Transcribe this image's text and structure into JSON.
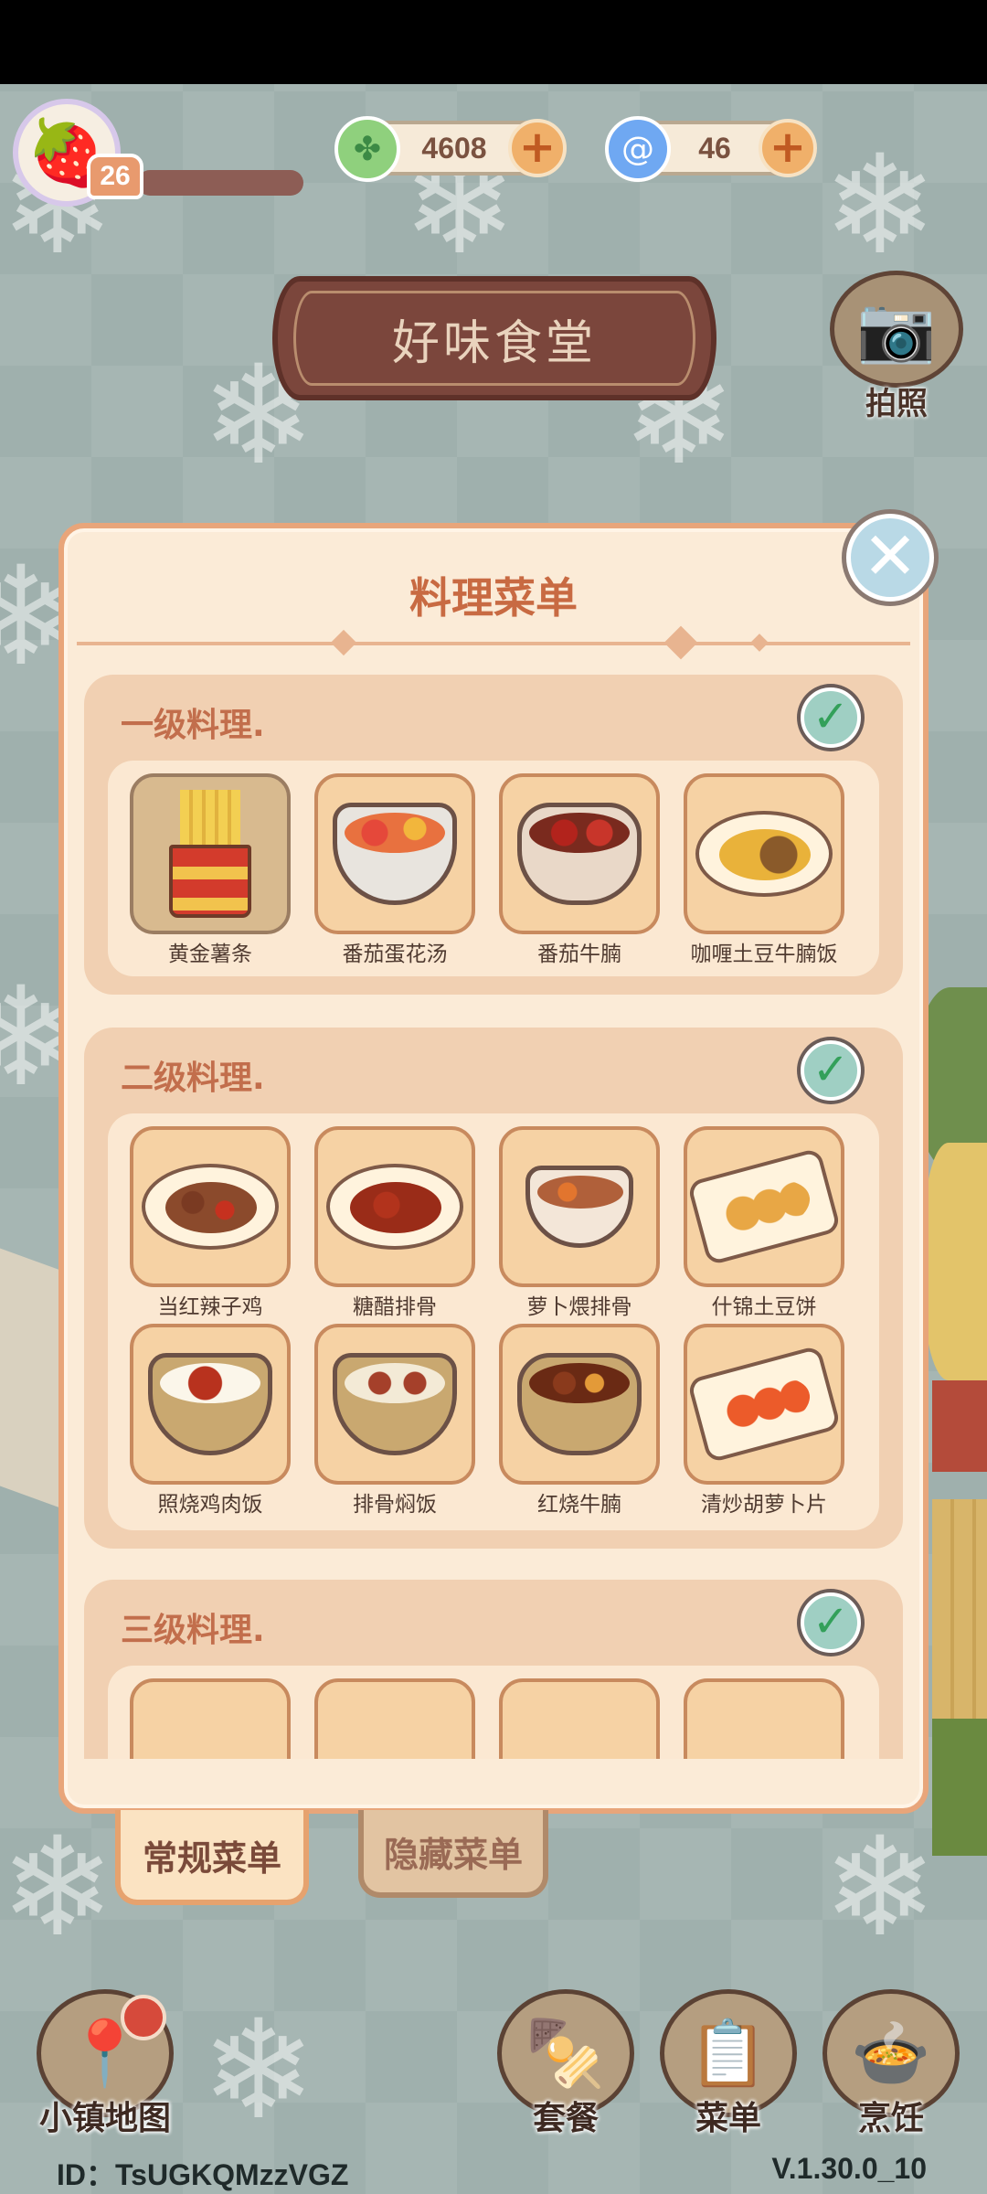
{
  "top_bar": {
    "player_level": "26",
    "currencies": [
      {
        "icon": "clover-coin-icon",
        "value": "4608",
        "color": "#8fd07d"
      },
      {
        "icon": "spiral-gem-icon",
        "value": "46",
        "color": "#6fa8f2"
      }
    ]
  },
  "restaurant_name": "好味食堂",
  "camera_label": "拍照",
  "menu_panel": {
    "title": "料理菜单",
    "sections": [
      {
        "title": "一级料理.",
        "completed": true,
        "dishes": [
          "黄金薯条",
          "番茄蛋花汤",
          "番茄牛腩",
          "咖喱土豆牛腩饭"
        ]
      },
      {
        "title": "二级料理.",
        "completed": true,
        "dishes": [
          "当红辣子鸡",
          "糖醋排骨",
          "萝卜煨排骨",
          "什锦土豆饼",
          "照烧鸡肉饭",
          "排骨焖饭",
          "红烧牛腩",
          "清炒胡萝卜片"
        ]
      },
      {
        "title": "三级料理.",
        "completed": true,
        "dishes": [
          "",
          "",
          "",
          ""
        ]
      }
    ]
  },
  "tabs": {
    "regular": "常规菜单",
    "hidden": "隐藏菜单"
  },
  "bottom_nav": {
    "map": "小镇地图",
    "combo": "套餐",
    "menu": "菜单",
    "cook": "烹饪"
  },
  "footer": {
    "user_id": "ID：TsUGKQMzzVGZ",
    "version": "V.1.30.0_10"
  },
  "colors": {
    "accent": "#c86a42",
    "panel": "#fbebd7",
    "tile": "#f6d2a4"
  }
}
